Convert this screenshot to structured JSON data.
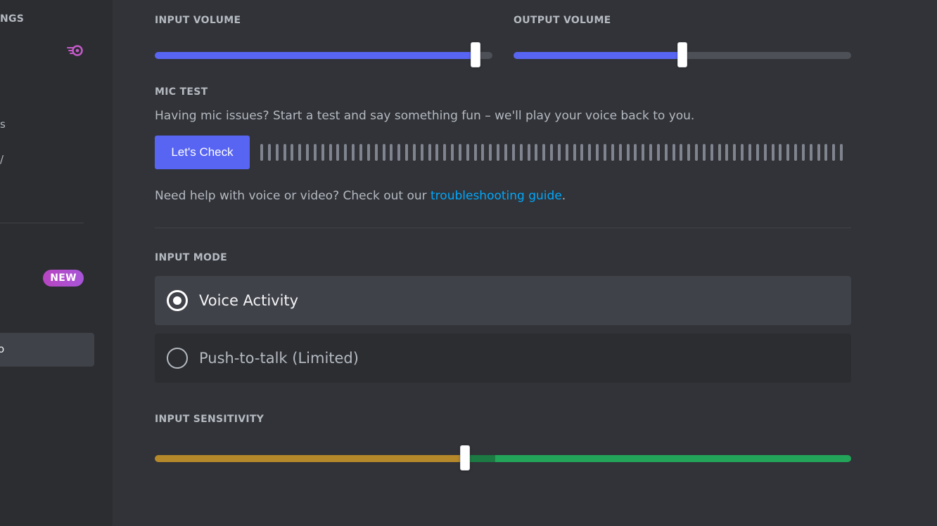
{
  "sidebar": {
    "heading_fragment": "NGS",
    "frag_1": "s",
    "frag_2": "/",
    "new_badge": "NEW",
    "selected_fragment": "o",
    "icons": [
      "nitro-icon"
    ]
  },
  "input_volume": {
    "label": "INPUT VOLUME",
    "value_percent": 95
  },
  "output_volume": {
    "label": "OUTPUT VOLUME",
    "value_percent": 50
  },
  "mic_test": {
    "label": "MIC TEST",
    "description": "Having mic issues? Start a test and say something fun – we'll play your voice back to you.",
    "button_label": "Let's Check",
    "meter_bars": 77
  },
  "help": {
    "prefix": "Need help with voice or video? Check out our ",
    "link_text": "troubleshooting guide",
    "suffix": "."
  },
  "input_mode": {
    "label": "INPUT MODE",
    "options": [
      {
        "label": "Voice Activity",
        "selected": true
      },
      {
        "label": "Push-to-talk (Limited)",
        "selected": false
      }
    ]
  },
  "input_sensitivity": {
    "label": "INPUT SENSITIVITY",
    "value_percent": 44.5
  },
  "colors": {
    "accent": "#5865f2",
    "link": "#00a8fc",
    "sens_low": "#b5882a",
    "sens_high": "#23a559",
    "sens_mid": "#1c7a43",
    "badge": "#b845c1"
  }
}
